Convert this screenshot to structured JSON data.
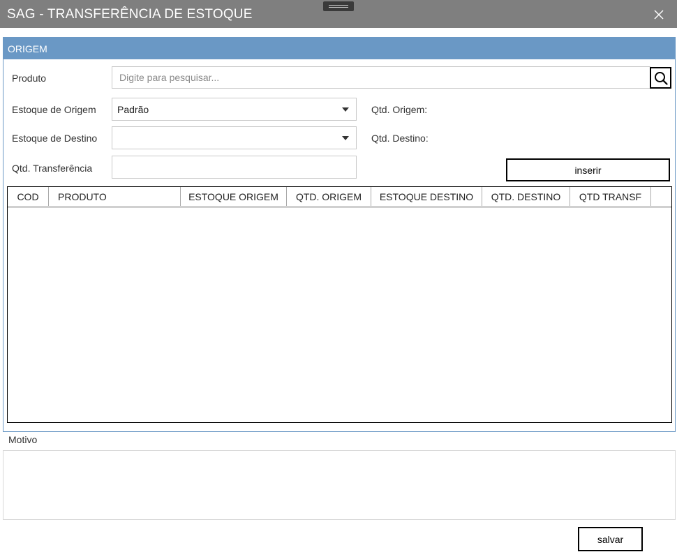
{
  "window": {
    "title": "SAG - TRANSFERÊNCIA DE ESTOQUE",
    "close_icon": "close-icon",
    "grip_icon": "drag-handle-icon"
  },
  "origem": {
    "title": "ORIGEM",
    "header_color": "#6a98c5",
    "produto_label": "Produto",
    "search_placeholder": "Digite para pesquisar...",
    "search_value": "",
    "search_icon": "search-icon",
    "estoque_origem_label": "Estoque de Origem",
    "estoque_origem_value": "Padrão",
    "estoque_destino_label": "Estoque de Destino",
    "estoque_destino_value": "",
    "qtd_origem_label": "Qtd. Origem:",
    "qtd_destino_label": "Qtd. Destino:",
    "qtd_transferencia_label": "Qtd. Transferência",
    "qtd_transferencia_value": "",
    "insert_label": "inserir"
  },
  "grid": {
    "columns": [
      "COD",
      "PRODUTO",
      "ESTOQUE ORIGEM",
      "QTD. ORIGEM",
      "ESTOQUE DESTINO",
      "QTD. DESTINO",
      "QTD TRANSF"
    ],
    "rows": []
  },
  "motivo": {
    "label": "Motivo",
    "value": ""
  },
  "footer": {
    "save_label": "salvar"
  }
}
